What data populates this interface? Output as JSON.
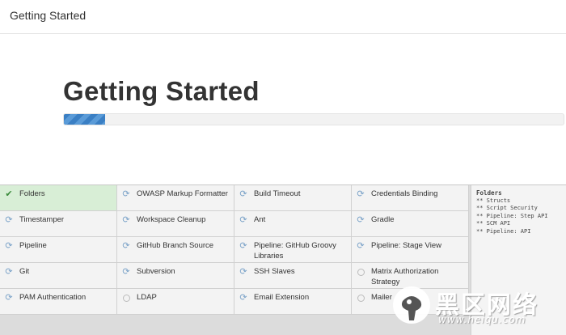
{
  "window": {
    "title": "Getting Started"
  },
  "hero": {
    "title": "Getting Started",
    "progress_fraction": 0.082
  },
  "colors": {
    "progress": "#3a7fc4",
    "success_cell": "#d8eed6",
    "grid_background": "#dcdcdc",
    "check_icon": "#3a8a3a",
    "refresh_icon": "#7aa2c8"
  },
  "plugins": [
    {
      "name": "Folders",
      "status": "success",
      "icon": "check-icon"
    },
    {
      "name": "OWASP Markup Formatter",
      "status": "installing",
      "icon": "refresh-icon"
    },
    {
      "name": "Build Timeout",
      "status": "installing",
      "icon": "refresh-icon"
    },
    {
      "name": "Credentials Binding",
      "status": "installing",
      "icon": "refresh-icon"
    },
    {
      "name": "Timestamper",
      "status": "installing",
      "icon": "refresh-icon"
    },
    {
      "name": "Workspace Cleanup",
      "status": "installing",
      "icon": "refresh-icon"
    },
    {
      "name": "Ant",
      "status": "installing",
      "icon": "refresh-icon"
    },
    {
      "name": "Gradle",
      "status": "installing",
      "icon": "refresh-icon"
    },
    {
      "name": "Pipeline",
      "status": "installing",
      "icon": "refresh-icon"
    },
    {
      "name": "GitHub Branch Source",
      "status": "installing",
      "icon": "refresh-icon"
    },
    {
      "name": "Pipeline: GitHub Groovy Libraries",
      "status": "installing",
      "icon": "refresh-icon"
    },
    {
      "name": "Pipeline: Stage View",
      "status": "installing",
      "icon": "refresh-icon"
    },
    {
      "name": "Git",
      "status": "installing",
      "icon": "refresh-icon"
    },
    {
      "name": "Subversion",
      "status": "installing",
      "icon": "refresh-icon"
    },
    {
      "name": "SSH Slaves",
      "status": "installing",
      "icon": "refresh-icon"
    },
    {
      "name": "Matrix Authorization Strategy",
      "status": "pending",
      "icon": "pending-circle-icon"
    },
    {
      "name": "PAM Authentication",
      "status": "installing",
      "icon": "refresh-icon"
    },
    {
      "name": "LDAP",
      "status": "pending",
      "icon": "pending-circle-icon"
    },
    {
      "name": "Email Extension",
      "status": "installing",
      "icon": "refresh-icon"
    },
    {
      "name": "Mailer",
      "status": "pending",
      "icon": "pending-circle-icon"
    }
  ],
  "log": {
    "title": "Folders",
    "lines": [
      "** Structs",
      "** Script Security",
      "** Pipeline: Step API",
      "** SCM API",
      "** Pipeline: API"
    ]
  },
  "watermark": {
    "text": "黑区网络",
    "url": "www.heiqu.com"
  }
}
